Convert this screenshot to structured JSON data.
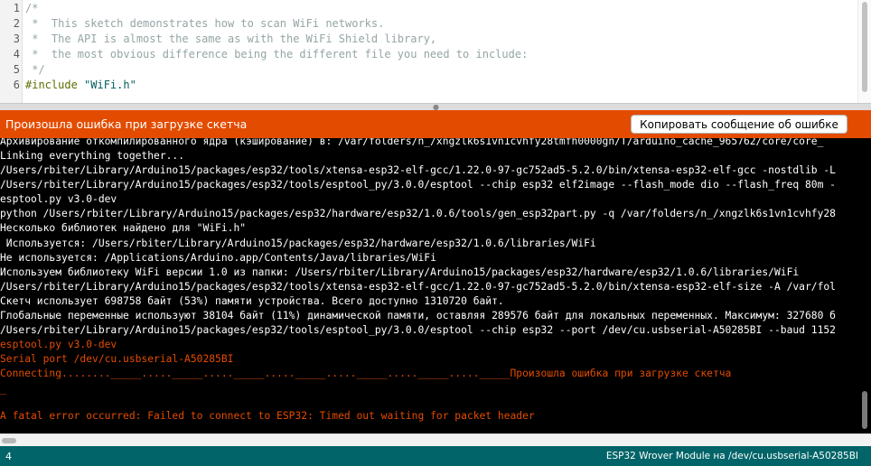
{
  "editor": {
    "line_numbers": [
      "1",
      "2",
      "3",
      "4",
      "5",
      "6"
    ],
    "lines": {
      "l1": "/*",
      "l2": " *  This sketch demonstrates how to scan WiFi networks.",
      "l3": " *  The API is almost the same as with the WiFi Shield library,",
      "l4": " *  the most obvious difference being the different file you need to include:",
      "l5": " */",
      "l6_directive": "#include",
      "l6_file": "\"WiFi.h\""
    }
  },
  "status_bar": {
    "message": "Произошла ошибка при загрузке скетча",
    "copy_button_label": "Копировать сообщение об ошибке"
  },
  "console": {
    "lines": [
      {
        "text": "Архивирование откомпилированного ядра (кэширование) в: /var/folders/n_/xngzlk6s1vn1cvhfy28tmfh0000gn/T/arduino_cache_965762/core/core_",
        "style": "normal"
      },
      {
        "text": "Linking everything together...",
        "style": "normal"
      },
      {
        "text": "/Users/rbiter/Library/Arduino15/packages/esp32/tools/xtensa-esp32-elf-gcc/1.22.0-97-gc752ad5-5.2.0/bin/xtensa-esp32-elf-gcc -nostdlib -L",
        "style": "normal"
      },
      {
        "text": "/Users/rbiter/Library/Arduino15/packages/esp32/tools/esptool_py/3.0.0/esptool --chip esp32 elf2image --flash_mode dio --flash_freq 80m -",
        "style": "normal"
      },
      {
        "text": "esptool.py v3.0-dev",
        "style": "normal"
      },
      {
        "text": "python /Users/rbiter/Library/Arduino15/packages/esp32/hardware/esp32/1.0.6/tools/gen_esp32part.py -q /var/folders/n_/xngzlk6s1vn1cvhfy28",
        "style": "normal"
      },
      {
        "text": "Несколько библиотек найдено для \"WiFi.h\"",
        "style": "normal"
      },
      {
        "text": " Используется: /Users/rbiter/Library/Arduino15/packages/esp32/hardware/esp32/1.0.6/libraries/WiFi",
        "style": "normal"
      },
      {
        "text": "Не используется: /Applications/Arduino.app/Contents/Java/libraries/WiFi",
        "style": "normal"
      },
      {
        "text": "Используем библиотеку WiFi версии 1.0 из папки: /Users/rbiter/Library/Arduino15/packages/esp32/hardware/esp32/1.0.6/libraries/WiFi",
        "style": "normal"
      },
      {
        "text": "/Users/rbiter/Library/Arduino15/packages/esp32/tools/xtensa-esp32-elf-gcc/1.22.0-97-gc752ad5-5.2.0/bin/xtensa-esp32-elf-size -A /var/fol",
        "style": "normal"
      },
      {
        "text": "Скетч использует 698758 байт (53%) памяти устройства. Всего доступно 1310720 байт.",
        "style": "normal"
      },
      {
        "text": "Глобальные переменные используют 38104 байт (11%) динамической памяти, оставляя 289576 байт для локальных переменных. Максимум: 327680 б",
        "style": "normal"
      },
      {
        "text": "/Users/rbiter/Library/Arduino15/packages/esp32/tools/esptool_py/3.0.0/esptool --chip esp32 --port /dev/cu.usbserial-A50285BI --baud 1152",
        "style": "normal"
      },
      {
        "text": "esptool.py v3.0-dev",
        "style": "err"
      },
      {
        "text": "Serial port /dev/cu.usbserial-A50285BI",
        "style": "err"
      },
      {
        "text": "Connecting........_____....._____....._____....._____....._____....._____....._____Произошла ошибка при загрузке скетча",
        "style": "err"
      },
      {
        "text": "_",
        "style": "err"
      },
      {
        "text": "A fatal error occurred: Failed to connect to ESP32: Timed out waiting for packet header",
        "style": "err"
      }
    ]
  },
  "footer": {
    "line_number": "4",
    "board_info": "ESP32 Wrover Module на /dev/cu.usbserial-A50285BI"
  },
  "colors": {
    "error_orange": "#e34c00",
    "footer_teal": "#006468",
    "console_bg": "#000000"
  }
}
